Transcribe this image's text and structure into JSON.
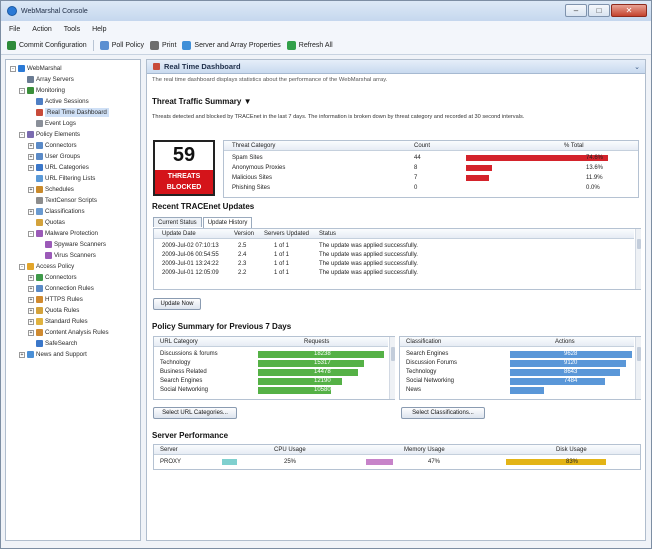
{
  "window": {
    "title": "WebMarshal Console",
    "minimize": "–",
    "maximize": "□",
    "close": "✕"
  },
  "menu": [
    "File",
    "Action",
    "Tools",
    "Help"
  ],
  "toolbar": [
    {
      "label": "Commit Configuration",
      "color": "#2e8b3a"
    },
    {
      "label": "Poll Policy",
      "color": "#5b8fd1"
    },
    {
      "label": "Print",
      "color": "#6e6e6e"
    },
    {
      "label": "Server and Array Properties",
      "color": "#3f8fd8"
    },
    {
      "label": "Refresh All",
      "color": "#32a04a"
    }
  ],
  "tree": [
    {
      "label": "WebMarshal",
      "depth": 0,
      "exp": "-",
      "color": "#2b7ad6"
    },
    {
      "label": "Array Servers",
      "depth": 1,
      "exp": "",
      "color": "#6b7c93"
    },
    {
      "label": "Monitoring",
      "depth": 1,
      "exp": "-",
      "color": "#3a8f3a"
    },
    {
      "label": "Active Sessions",
      "depth": 2,
      "exp": "",
      "color": "#4f7fc4"
    },
    {
      "label": "Real Time Dashboard",
      "depth": 2,
      "exp": "",
      "color": "#c84b3a"
    },
    {
      "label": "Event Logs",
      "depth": 2,
      "exp": "",
      "color": "#8a8f99"
    },
    {
      "label": "Policy Elements",
      "depth": 1,
      "exp": "-",
      "color": "#7a6bb0"
    },
    {
      "label": "Connectors",
      "depth": 2,
      "exp": "+",
      "color": "#5a8ac7"
    },
    {
      "label": "User Groups",
      "depth": 2,
      "exp": "+",
      "color": "#5a8ac7"
    },
    {
      "label": "URL Categories",
      "depth": 2,
      "exp": "+",
      "color": "#3b77c9"
    },
    {
      "label": "URL Filtering Lists",
      "depth": 2,
      "exp": "",
      "color": "#5b9ad8"
    },
    {
      "label": "Schedules",
      "depth": 2,
      "exp": "+",
      "color": "#c98a2b"
    },
    {
      "label": "TextCensor Scripts",
      "depth": 2,
      "exp": "",
      "color": "#8c8c8c"
    },
    {
      "label": "Classifications",
      "depth": 2,
      "exp": "+",
      "color": "#6a9ad0"
    },
    {
      "label": "Quotas",
      "depth": 2,
      "exp": "",
      "color": "#d3a23b"
    },
    {
      "label": "Malware Protection",
      "depth": 2,
      "exp": "-",
      "color": "#9b5ab8"
    },
    {
      "label": "Spyware Scanners",
      "depth": 3,
      "exp": "",
      "color": "#9b5ab8"
    },
    {
      "label": "Virus Scanners",
      "depth": 3,
      "exp": "",
      "color": "#9b5ab8"
    },
    {
      "label": "Access Policy",
      "depth": 1,
      "exp": "-",
      "color": "#e2a52b"
    },
    {
      "label": "Connectors",
      "depth": 2,
      "exp": "+",
      "color": "#3f9a4a"
    },
    {
      "label": "Connection Rules",
      "depth": 2,
      "exp": "+",
      "color": "#5a8ac7"
    },
    {
      "label": "HTTPS Rules",
      "depth": 2,
      "exp": "+",
      "color": "#d08a2f"
    },
    {
      "label": "Quota Rules",
      "depth": 2,
      "exp": "+",
      "color": "#d3a23b"
    },
    {
      "label": "Standard Rules",
      "depth": 2,
      "exp": "+",
      "color": "#e0b23f"
    },
    {
      "label": "Content Analysis Rules",
      "depth": 2,
      "exp": "+",
      "color": "#cf8a30"
    },
    {
      "label": "SafeSearch",
      "depth": 2,
      "exp": "",
      "color": "#3b77c9"
    },
    {
      "label": "News and Support",
      "depth": 1,
      "exp": "+",
      "color": "#4a8fd6"
    }
  ],
  "main": {
    "title": "Real Time Dashboard",
    "collapse": "⌄",
    "description": "The real time dashboard displays statistics about the performance of the WebMarshal array.",
    "threat_header": "Threat Traffic Summary",
    "threat_sub": "Threats detected and blocked by TRACEnet in the last 7 days. The information is broken down by threat category and recorded at 30 second intervals.",
    "threat_count": "59",
    "threat_label": "THREATS BLOCKED",
    "threat_cols": [
      "Threat Category",
      "Count",
      "% Total"
    ],
    "threat_rows": [
      {
        "category": "Spam Sites",
        "count": "44",
        "pct": "74.6%",
        "frac": 0.746
      },
      {
        "category": "Anonymous Proxies",
        "count": "8",
        "pct": "13.6%",
        "frac": 0.136
      },
      {
        "category": "Malicious Sites",
        "count": "7",
        "pct": "11.9%",
        "frac": 0.119
      },
      {
        "category": "Phishing Sites",
        "count": "0",
        "pct": "0.0%",
        "frac": 0.0
      }
    ],
    "tracenet_header": "Recent TRACEnet Updates",
    "tabs": [
      "Current Status",
      "Update History"
    ],
    "update_cols": [
      "Update Date",
      "Version",
      "Servers Updated",
      "Status"
    ],
    "updates": [
      {
        "date": "2009-Jul-02 07:10:13",
        "version": "2.5",
        "servers": "1 of 1",
        "status": "The update was applied successfully."
      },
      {
        "date": "2009-Jul-06 00:54:55",
        "version": "2.4",
        "servers": "1 of 1",
        "status": "The update was applied successfully."
      },
      {
        "date": "2009-Jul-01 13:24:22",
        "version": "2.3",
        "servers": "1 of 1",
        "status": "The update was applied successfully."
      },
      {
        "date": "2009-Jul-01 12:05:09",
        "version": "2.2",
        "servers": "1 of 1",
        "status": "The update was applied successfully."
      }
    ],
    "update_button": "Update Now",
    "policy_header": "Policy Summary for Previous 7 Days",
    "url_cols": [
      "URL Category",
      "Requests"
    ],
    "url_rows": [
      {
        "label": "Discussions & forums",
        "value": "18238",
        "frac": 1.0
      },
      {
        "label": "Technology",
        "value": "15317",
        "frac": 0.84
      },
      {
        "label": "Business Related",
        "value": "14478",
        "frac": 0.79
      },
      {
        "label": "Search Engines",
        "value": "12190",
        "frac": 0.67
      },
      {
        "label": "Social Networking",
        "value": "10580",
        "frac": 0.58
      }
    ],
    "url_button": "Select URL Categories...",
    "class_cols": [
      "Classification",
      "Actions"
    ],
    "class_rows": [
      {
        "label": "Search Engines",
        "value": "9628",
        "frac": 1.0
      },
      {
        "label": "Discussion Forums",
        "value": "9120",
        "frac": 0.95
      },
      {
        "label": "Technology",
        "value": "8643",
        "frac": 0.9
      },
      {
        "label": "Social Networking",
        "value": "7484",
        "frac": 0.78
      },
      {
        "label": "News",
        "value": "2723",
        "frac": 0.28
      }
    ],
    "class_button": "Select Classifications...",
    "server_header": "Server Performance",
    "server_cols": [
      "Server",
      "CPU Usage",
      "Memory Usage",
      "Disk Usage"
    ],
    "server_row": {
      "name": "PROXY",
      "cpu": "25%",
      "cpu_frac": 0.25,
      "mem": "47%",
      "mem_frac": 0.47,
      "disk": "83%",
      "disk_frac": 0.83
    },
    "colors": {
      "threat_bar": "#d4232b",
      "url_bar": "#55b146",
      "class_bar": "#5a97d8",
      "cpu": "#7fd0cf",
      "mem": "#c783c9",
      "disk": "#e3b417"
    }
  }
}
